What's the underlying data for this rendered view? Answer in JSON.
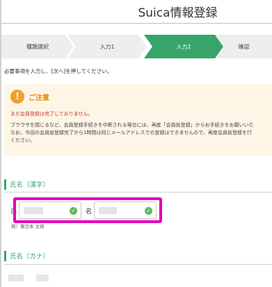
{
  "header": {
    "title": "Suica情報登録"
  },
  "steps": [
    {
      "label": "種類選択",
      "active": false
    },
    {
      "label": "入力1",
      "active": false
    },
    {
      "label": "入力2",
      "active": true
    },
    {
      "label": "確認",
      "active": false
    }
  ],
  "instruction": "必要事項を入力し、[次へ]を押してください。",
  "notice": {
    "title": "ご注意",
    "warning": "まだ会員登録は完了しておりません。",
    "lines": [
      "ブラウザを閉じるなど、会員登録手続きを中断される場合には、再度「会員仮登録」からお手続きをお願いいた",
      "なお、今回の会員仮登録完了から1時間は同じメールアドレスでの登録はできませんので、再度会員仮登録を行",
      "ください。"
    ]
  },
  "name_kanji": {
    "heading": "氏名（漢字）",
    "surname_label": "氏",
    "given_label": "名",
    "example": "例）東日本 太郎"
  },
  "name_kana": {
    "heading": "氏名（カナ）"
  },
  "colors": {
    "accent": "#37a569",
    "highlight": "#e600b8",
    "notice_bg": "#fdf5e6",
    "warning": "#d0342c"
  }
}
